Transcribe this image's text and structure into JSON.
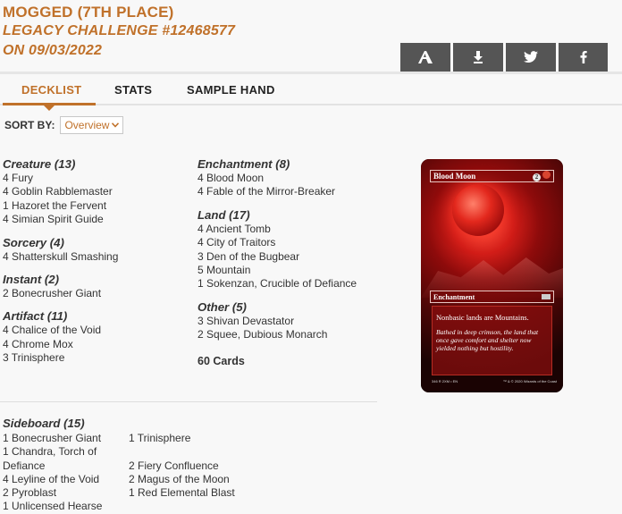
{
  "header": {
    "line1": "MOGGED (7TH PLACE)",
    "line2": "LEGACY CHALLENGE #12468577",
    "line3": "ON 09/03/2022"
  },
  "share": {
    "items": [
      {
        "icon": "arena-icon"
      },
      {
        "icon": "download-icon"
      },
      {
        "icon": "twitter-icon"
      },
      {
        "icon": "facebook-icon"
      }
    ]
  },
  "tabs": [
    "DECKLIST",
    "STATS",
    "SAMPLE HAND"
  ],
  "sort": {
    "label": "SORT BY:",
    "selected": "Overview"
  },
  "left_sections": [
    {
      "title": "Creature (13)",
      "cards": [
        "4 Fury",
        "4 Goblin Rabblemaster",
        "1 Hazoret the Fervent",
        "4 Simian Spirit Guide"
      ]
    },
    {
      "title": "Sorcery (4)",
      "cards": [
        "4 Shatterskull Smashing"
      ]
    },
    {
      "title": "Instant (2)",
      "cards": [
        "2 Bonecrusher Giant"
      ]
    },
    {
      "title": "Artifact (11)",
      "cards": [
        "4 Chalice of the Void",
        "4 Chrome Mox",
        "3 Trinisphere"
      ]
    }
  ],
  "right_sections": [
    {
      "title": "Enchantment (8)",
      "cards": [
        "4 Blood Moon",
        "4 Fable of the Mirror-Breaker"
      ]
    },
    {
      "title": "Land (17)",
      "cards": [
        "4 Ancient Tomb",
        "4 City of Traitors",
        "3 Den of the Bugbear",
        "5 Mountain",
        "1 Sokenzan, Crucible of Defiance"
      ]
    },
    {
      "title": "Other (5)",
      "cards": [
        "3 Shivan Devastator",
        "2 Squee, Dubious Monarch"
      ]
    }
  ],
  "total": "60 Cards",
  "sideboard": {
    "title": "Sideboard (15)",
    "col1": [
      "1 Bonecrusher Giant",
      "1 Chandra, Torch of Defiance",
      "4 Leyline of the Void",
      "2 Pyroblast",
      "1 Unlicensed Hearse"
    ],
    "col2": [
      "1 Trinisphere",
      "2 Fiery Confluence",
      "2 Magus of the Moon",
      "1 Red Elemental Blast"
    ]
  },
  "card_preview": {
    "name": "Blood Moon",
    "cost_generic": "2",
    "type": "Enchantment",
    "rules": "Nonbasic lands are Mountains.",
    "flavor": "Bathed in deep crimson, the land that once gave comfort and shelter now yielded nothing but hostility.",
    "footer_left": "346 R 2XM • EN",
    "footer_right": "™ & © 2020 Wizards of the Coast",
    "colors": {
      "frame": "#161616",
      "accent": "#d21d18"
    }
  },
  "colors": {
    "accent": "#c0712a",
    "button": "#555555",
    "background": "#f8f8f8"
  }
}
